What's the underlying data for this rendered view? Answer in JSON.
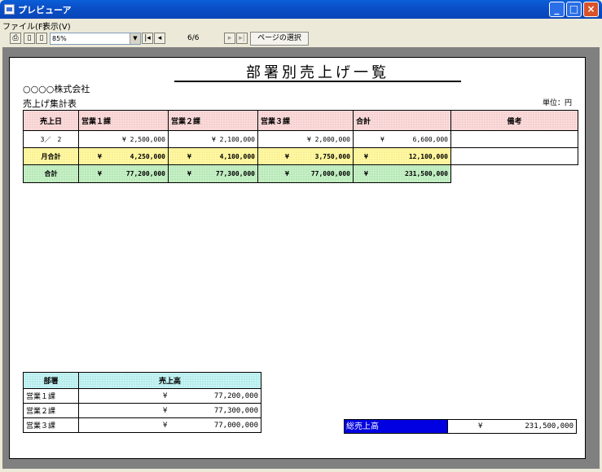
{
  "window": {
    "title": "プレビューア"
  },
  "menu": [
    "ファイル(F)",
    "表示(V)"
  ],
  "toolbar": {
    "zoom": "85%",
    "page_indicator": "6/6",
    "page_select_label": "ページの選択"
  },
  "report": {
    "title": "部署別売上げ一覧",
    "company": "○○○○株式会社",
    "subtitle": "売上げ集計表",
    "unit": "単位：円",
    "headers": [
      "売上日",
      "営業１課",
      "営業２課",
      "営業３課",
      "合計",
      "備考"
    ],
    "day_row": {
      "date": "3／　2",
      "values": [
        "¥ 2,500,000",
        "¥ 2,100,000",
        "¥ 2,000,000"
      ],
      "total": "6,600,000",
      "note": ""
    },
    "month_row": {
      "label": "月合計",
      "values": [
        "4,250,000",
        "4,100,000",
        "3,750,000",
        "12,100,000"
      ]
    },
    "total_row": {
      "label": "合計",
      "values": [
        "77,200,000",
        "77,300,000",
        "77,000,000",
        "231,500,000"
      ]
    },
    "yen": "¥",
    "summary": {
      "headers": [
        "部署",
        "売上高"
      ],
      "rows": [
        {
          "dept": "営業１課",
          "amount": "77,200,000"
        },
        {
          "dept": "営業２課",
          "amount": "77,300,000"
        },
        {
          "dept": "営業３課",
          "amount": "77,000,000"
        }
      ]
    },
    "grand_total": {
      "label": "総売上高",
      "amount": "231,500,000"
    }
  }
}
